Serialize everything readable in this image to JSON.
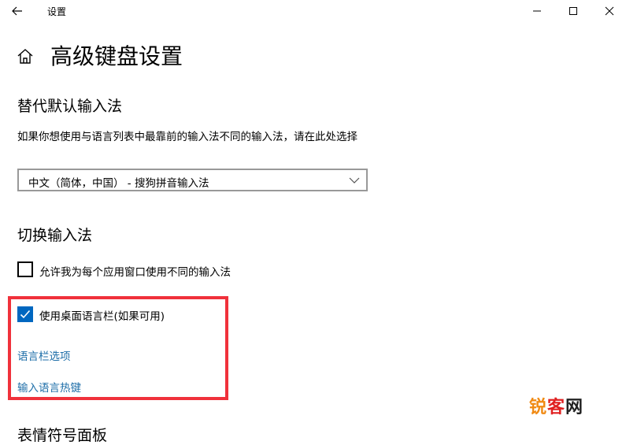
{
  "window": {
    "title": "设置",
    "minimize_icon": "minimize-icon",
    "maximize_icon": "maximize-icon",
    "close_icon": "close-icon"
  },
  "header": {
    "back_icon": "back-arrow-icon",
    "home_icon": "home-icon",
    "page_title": "高级键盘设置"
  },
  "override_input": {
    "heading": "替代默认输入法",
    "description": "如果你想使用与语言列表中最靠前的输入法不同的输入法，请在此处选择",
    "dropdown_value": "中文（简体，中国） - 搜狗拼音输入法"
  },
  "switching": {
    "heading": "切换输入法",
    "per_app_checkbox": {
      "label": "允许我为每个应用窗口使用不同的输入法",
      "checked": false
    },
    "language_bar_checkbox": {
      "label": "使用桌面语言栏(如果可用)",
      "checked": true
    },
    "language_bar_options_link": "语言栏选项",
    "input_hotkeys_link": "输入语言热键"
  },
  "next_section": {
    "heading": "表情符号面板"
  },
  "watermark": {
    "part1": "锐",
    "part2": "客",
    "part3": "网"
  },
  "colors": {
    "accent": "#0067c0",
    "link": "#1e6ea8",
    "highlight": "#f0313b"
  }
}
